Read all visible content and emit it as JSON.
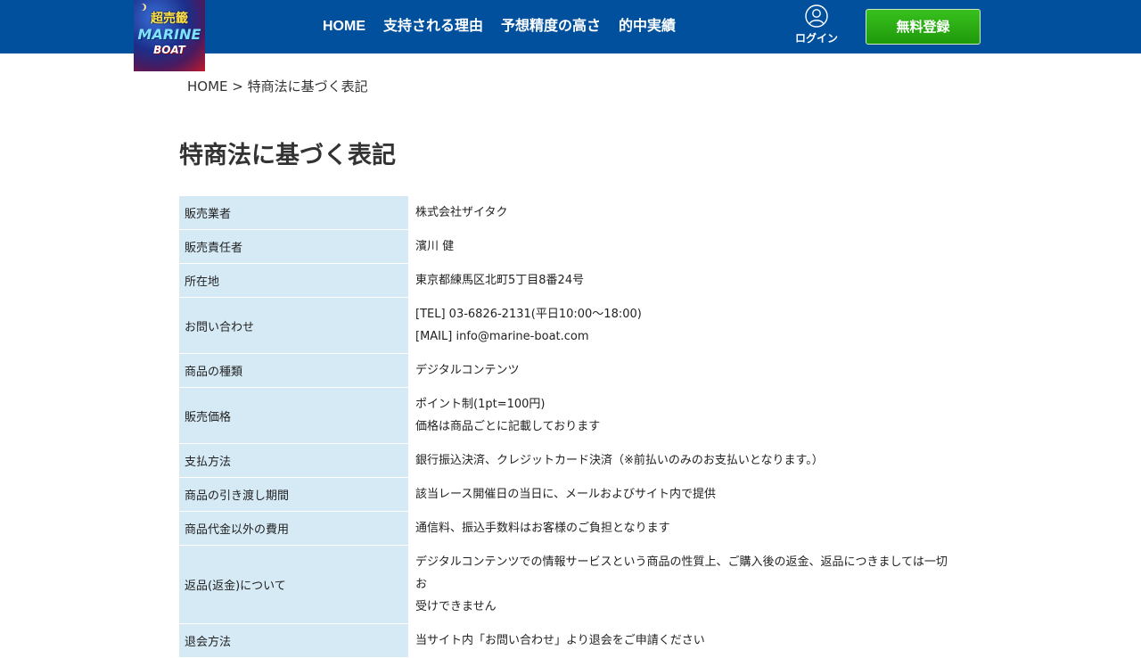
{
  "header": {
    "logo": {
      "top": "超売籤",
      "main": "MARINE",
      "sub": "BOAT"
    },
    "nav": [
      "HOME",
      "支持される理由",
      "予想精度の高さ",
      "的中実績"
    ],
    "login_label": "ログイン",
    "register_label": "無料登録",
    "colors": {
      "bar": "#00509e",
      "register": "#2aa814"
    }
  },
  "breadcrumb": {
    "home": "HOME",
    "separator": ">",
    "current": "特商法に基づく表記"
  },
  "page_title": "特商法に基づく表記",
  "table": {
    "rows": [
      {
        "label": "販売業者",
        "lines": [
          "株式会社ザイタク"
        ]
      },
      {
        "label": "販売責任者",
        "lines": [
          "濱川 健"
        ]
      },
      {
        "label": "所在地",
        "lines": [
          "東京都練馬区北町5丁目8番24号"
        ]
      },
      {
        "label": "お問い合わせ",
        "lines": [
          "[TEL] 03-6826-2131(平日10:00〜18:00)",
          "[MAIL] info@marine-boat.com"
        ]
      },
      {
        "label": "商品の種類",
        "lines": [
          "デジタルコンテンツ"
        ]
      },
      {
        "label": "販売価格",
        "lines": [
          "ポイント制(1pt=100円)",
          "価格は商品ごとに記載しております"
        ]
      },
      {
        "label": "支払方法",
        "lines": [
          "銀行振込決済、クレジットカード決済（※前払いのみのお支払いとなります。）"
        ]
      },
      {
        "label": "商品の引き渡し期間",
        "lines": [
          "該当レース開催日の当日に、メールおよびサイト内で提供"
        ]
      },
      {
        "label": "商品代金以外の費用",
        "lines": [
          "通信料、振込手数料はお客様のご負担となります"
        ]
      },
      {
        "label": "返品(返金)について",
        "lines": [
          "デジタルコンテンツでの情報サービスという商品の性質上、ご購入後の返金、返品につきましては一切お",
          "受けできません"
        ]
      },
      {
        "label": "退会方法",
        "lines": [
          "当サイト内「お問い合わせ」より退会をご申請ください"
        ]
      }
    ]
  }
}
